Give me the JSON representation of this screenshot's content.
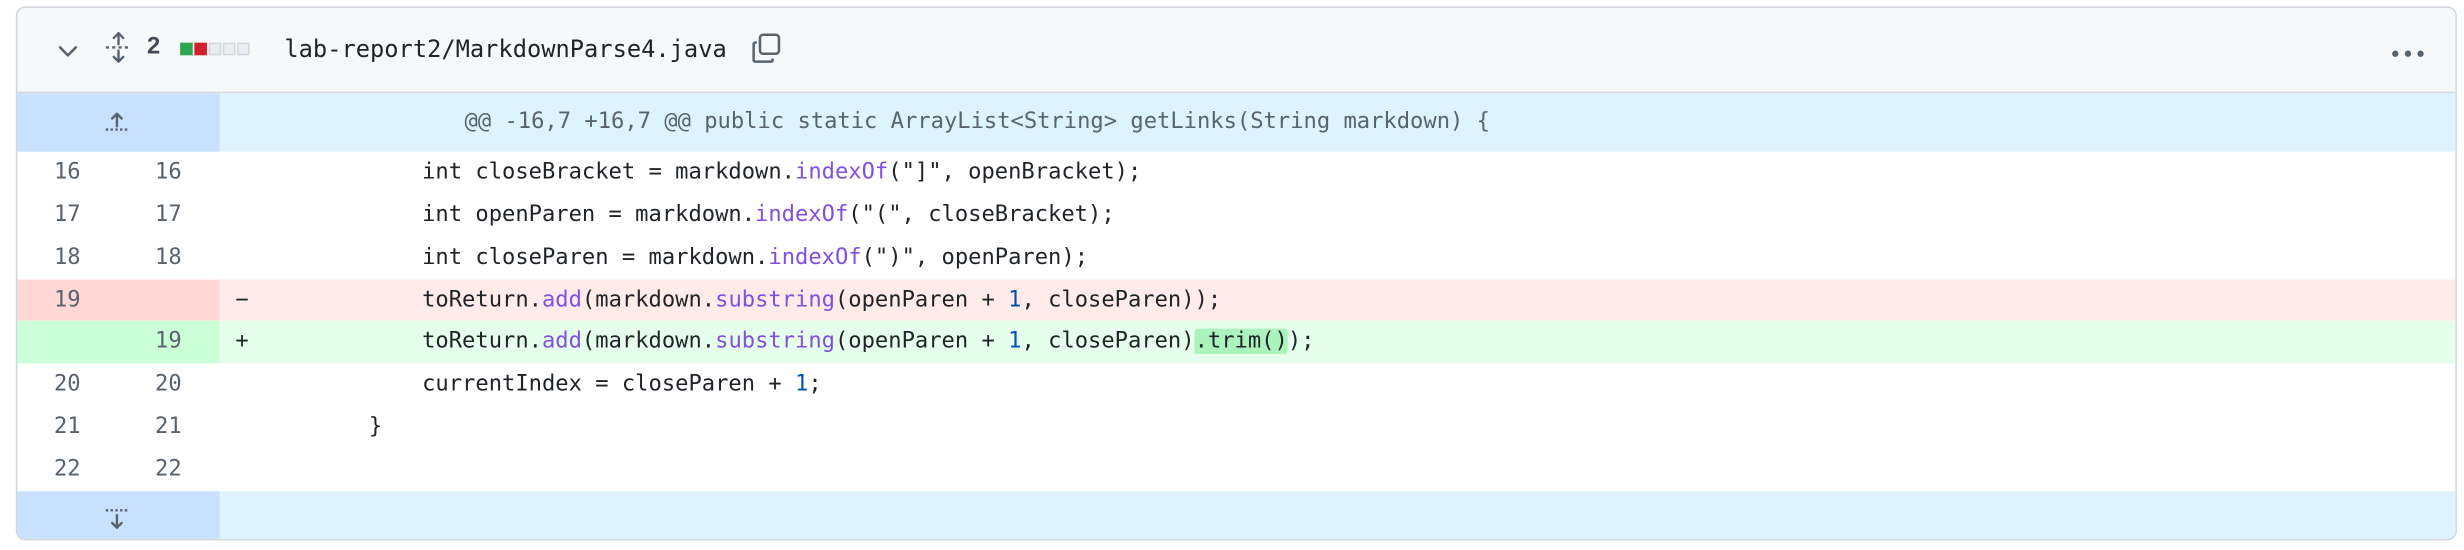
{
  "file": {
    "change_count": "2",
    "path": "lab-report2/MarkdownParse4.java",
    "diffstat": [
      "add",
      "del",
      "neu",
      "neu",
      "neu"
    ]
  },
  "icons": {
    "collapse": "chevron-down-icon",
    "expand_all": "unfold-icon",
    "copy": "copy-icon",
    "more": "kebab-horizontal-icon",
    "expand_up": "fold-up-icon",
    "expand_down": "fold-down-icon"
  },
  "hunk_header": "@@ -16,7 +16,7 @@ public static ArrayList<String> getLinks(String markdown) {",
  "lines": [
    {
      "old": "16",
      "new": "16",
      "type": "ctx",
      "marker": "",
      "indent": "            ",
      "tokens": [
        [
          "int closeBracket = markdown.",
          ""
        ],
        [
          "indexOf",
          "fn"
        ],
        [
          "(\"]\", openBracket);",
          ""
        ]
      ]
    },
    {
      "old": "17",
      "new": "17",
      "type": "ctx",
      "marker": "",
      "indent": "            ",
      "tokens": [
        [
          "int openParen = markdown.",
          ""
        ],
        [
          "indexOf",
          "fn"
        ],
        [
          "(\"(\", closeBracket);",
          ""
        ]
      ]
    },
    {
      "old": "18",
      "new": "18",
      "type": "ctx",
      "marker": "",
      "indent": "            ",
      "tokens": [
        [
          "int closeParen = markdown.",
          ""
        ],
        [
          "indexOf",
          "fn"
        ],
        [
          "(\")\", openParen);",
          ""
        ]
      ]
    },
    {
      "old": "19",
      "new": "",
      "type": "del",
      "marker": "−",
      "indent": "            ",
      "tokens": [
        [
          "toReturn.",
          ""
        ],
        [
          "add",
          "fn"
        ],
        [
          "(markdown.",
          ""
        ],
        [
          "substring",
          "fn"
        ],
        [
          "(openParen + ",
          ""
        ],
        [
          "1",
          "nm"
        ],
        [
          ", closeParen));",
          ""
        ]
      ]
    },
    {
      "old": "",
      "new": "19",
      "type": "add",
      "marker": "+",
      "indent": "            ",
      "tokens": [
        [
          "toReturn.",
          ""
        ],
        [
          "add",
          "fn"
        ],
        [
          "(markdown.",
          ""
        ],
        [
          "substring",
          "fn"
        ],
        [
          "(openParen + ",
          ""
        ],
        [
          "1",
          "nm"
        ],
        [
          ", closeParen)",
          ""
        ],
        [
          ".trim()",
          "hl"
        ],
        [
          ");",
          ""
        ]
      ]
    },
    {
      "old": "20",
      "new": "20",
      "type": "ctx",
      "marker": "",
      "indent": "            ",
      "tokens": [
        [
          "currentIndex = closeParen + ",
          ""
        ],
        [
          "1",
          "nm"
        ],
        [
          ";",
          ""
        ]
      ]
    },
    {
      "old": "21",
      "new": "21",
      "type": "ctx",
      "marker": "",
      "indent": "        ",
      "tokens": [
        [
          "}",
          ""
        ]
      ]
    },
    {
      "old": "22",
      "new": "22",
      "type": "ctx",
      "marker": "",
      "indent": "",
      "tokens": [
        [
          "",
          ""
        ]
      ]
    }
  ]
}
